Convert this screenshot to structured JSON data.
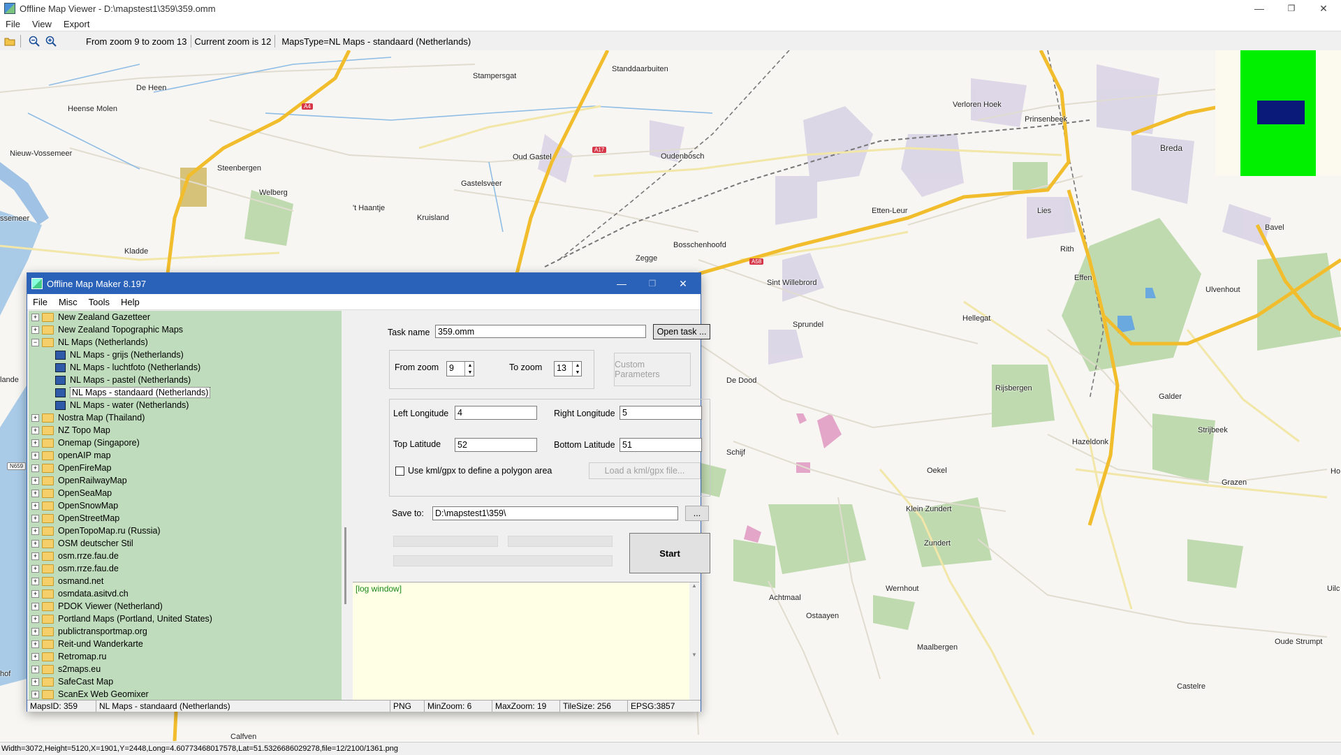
{
  "window": {
    "title": "Offline Map Viewer - D:\\mapstest1\\359\\359.omm",
    "min": "—",
    "max": "❐",
    "close": "✕"
  },
  "menu": [
    "File",
    "View",
    "Export"
  ],
  "toolbar": {
    "zoom_range": "From zoom 9 to zoom 13",
    "current_zoom": "Current zoom is 12",
    "maps_type": "MapsType=NL Maps - standaard (Netherlands)"
  },
  "map": {
    "places": [
      "De Heen",
      "Heense Molen",
      "Nieuw-Vossemeer",
      "ssemeer",
      "Steenbergen",
      "Welberg",
      "Kladde",
      "'t Haantje",
      "Kruisland",
      "Stampersgat",
      "Standdaarbuiten",
      "Oud Gastel",
      "Oudenbosch",
      "Gastelsveer",
      "Bosschenhoofd",
      "Zegge",
      "Verloren Hoek",
      "Prinsenbeek",
      "Breda",
      "Etten-Leur",
      "Lies",
      "Bavel",
      "Rith",
      "Effen",
      "Ulvenhout",
      "Sint Willebrord",
      "Sprundel",
      "Hellegat",
      "De Dood",
      "Rijsbergen",
      "Galder",
      "Strijbeek",
      "Schijf",
      "Hazeldonk",
      "Oekel",
      "Grazen",
      "Klein Zundert",
      "Zundert",
      "Wernhout",
      "Achtmaal",
      "Ostaayen",
      "Maalbergen",
      "Oude Strumpt",
      "Castelre",
      "Calfven",
      "lande",
      "hof",
      "Uilc",
      "Ho"
    ],
    "roads": [
      "A4",
      "A17",
      "A58",
      "N659"
    ]
  },
  "status": "Width=3072,Height=5120,X=1901,Y=2448,Long=4.60773468017578,Lat=51.5326686029278,file=12/2100/1361.png",
  "dialog": {
    "title": "Offline Map Maker 8.197",
    "menu": [
      "File",
      "Misc",
      "Tools",
      "Help"
    ],
    "tree": [
      {
        "label": "New Zealand Gazetteer",
        "type": "folder"
      },
      {
        "label": "New Zealand Topographic Maps",
        "type": "folder"
      },
      {
        "label": "NL Maps (Netherlands)",
        "type": "open"
      },
      {
        "label": "NL Maps - grijs (Netherlands)",
        "type": "map"
      },
      {
        "label": "NL Maps - luchtfoto (Netherlands)",
        "type": "map"
      },
      {
        "label": "NL Maps - pastel (Netherlands)",
        "type": "map"
      },
      {
        "label": "NL Maps - standaard (Netherlands)",
        "type": "map",
        "selected": true
      },
      {
        "label": "NL Maps - water (Netherlands)",
        "type": "map"
      },
      {
        "label": "Nostra Map (Thailand)",
        "type": "folder"
      },
      {
        "label": "NZ Topo Map",
        "type": "folder"
      },
      {
        "label": "Onemap (Singapore)",
        "type": "folder"
      },
      {
        "label": "openAIP map",
        "type": "folder"
      },
      {
        "label": "OpenFireMap",
        "type": "folder"
      },
      {
        "label": "OpenRailwayMap",
        "type": "folder"
      },
      {
        "label": "OpenSeaMap",
        "type": "folder"
      },
      {
        "label": "OpenSnowMap",
        "type": "folder"
      },
      {
        "label": "OpenStreetMap",
        "type": "folder"
      },
      {
        "label": "OpenTopoMap.ru (Russia)",
        "type": "folder"
      },
      {
        "label": "OSM deutscher Stil",
        "type": "folder"
      },
      {
        "label": "osm.rrze.fau.de",
        "type": "folder"
      },
      {
        "label": "osm.rrze.fau.de",
        "type": "folder"
      },
      {
        "label": "osmand.net",
        "type": "folder"
      },
      {
        "label": "osmdata.asitvd.ch",
        "type": "folder"
      },
      {
        "label": "PDOK Viewer (Netherland)",
        "type": "folder"
      },
      {
        "label": "Portland Maps (Portland, United States)",
        "type": "folder"
      },
      {
        "label": "publictransportmap.org",
        "type": "folder"
      },
      {
        "label": "Reit-und Wanderkarte",
        "type": "folder"
      },
      {
        "label": "Retromap.ru",
        "type": "folder"
      },
      {
        "label": "s2maps.eu",
        "type": "folder"
      },
      {
        "label": "SafeCast Map",
        "type": "folder"
      },
      {
        "label": "ScanEx Web Geomixer",
        "type": "folder"
      }
    ],
    "task_name_label": "Task name",
    "task_name": "359.omm",
    "open_task": "Open task ...",
    "from_zoom_label": "From zoom",
    "from_zoom": "9",
    "to_zoom_label": "To zoom",
    "to_zoom": "13",
    "custom_params": "Custom Parameters",
    "left_lon_label": "Left Longitude",
    "left_lon": "4",
    "right_lon_label": "Right Longitude",
    "right_lon": "5",
    "top_lat_label": "Top Latitude",
    "top_lat": "52",
    "bottom_lat_label": "Bottom Latitude",
    "bottom_lat": "51",
    "kml_label": "Use kml/gpx to define a polygon area",
    "load_kml": "Load a kml/gpx file...",
    "save_to_label": "Save to:",
    "save_to": "D:\\mapstest1\\359\\",
    "browse": "...",
    "start": "Start",
    "log": "[log window]",
    "status": {
      "maps_id": "MapsID: 359",
      "name": "NL Maps - standaard (Netherlands)",
      "format": "PNG",
      "min_zoom": "MinZoom: 6",
      "max_zoom": "MaxZoom: 19",
      "tile_size": "TileSize: 256",
      "epsg": "EPSG:3857"
    }
  }
}
